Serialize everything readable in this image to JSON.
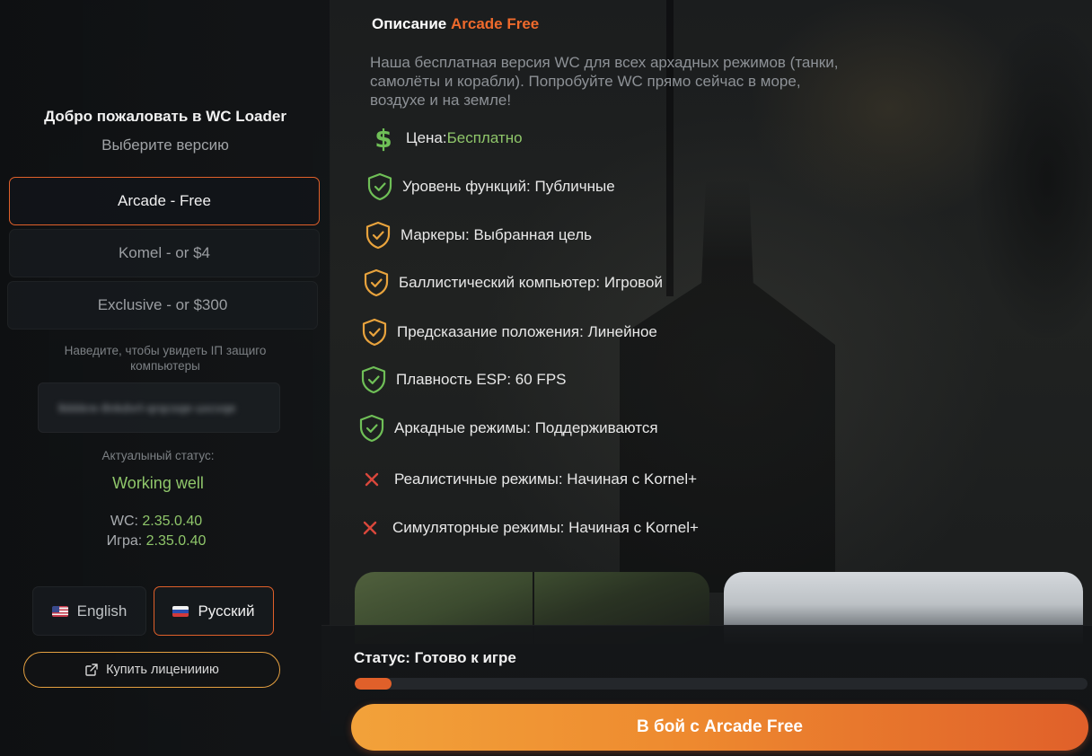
{
  "sidebar": {
    "welcome": "Добро пожаловать в WC Loader",
    "choose_version": "Выберите версию",
    "versions": [
      {
        "label": "Arcade - Free",
        "active": true
      },
      {
        "label": "Komel - or $4",
        "active": false
      },
      {
        "label": "Exclusive - or $300",
        "active": false
      }
    ],
    "ip_hint": "Наведите, чтобы увидеть IП защиго компьютеры",
    "ip_value": "lkkkkre-8nkdvrl-qrqcsqe-uxcvqe",
    "status_label": "Актуалыный статус:",
    "status_value": "Working well",
    "wc_label": "WC:",
    "wc_version": "2.35.0.40",
    "game_label": "Игра:",
    "game_version": "2.35.0.40",
    "languages": [
      {
        "label": "English",
        "flag": "us",
        "active": false
      },
      {
        "label": "Русский",
        "flag": "ru",
        "active": true
      }
    ],
    "buy_label": "Купить лиценииию"
  },
  "main": {
    "title_prefix": "Описание ",
    "title_accent": "Arcade Free",
    "description": "Наша бесплатная версия WC для всех архадных режимов (танки, самолёты и корабли). Попробуйте WC прямо сейчас в море, воздухе и на земле!",
    "price_label": "Цена: ",
    "price_value": "Бесплатно",
    "features": [
      {
        "text": "Уровень функций: Публичные",
        "icon": "shield-check-icon",
        "color": "#6fbf57"
      },
      {
        "text": "Маркеры: Выбранная цель",
        "icon": "shield-check-icon",
        "color": "#e8a33d"
      },
      {
        "text": "Баллистический компьютер: Игровой",
        "icon": "shield-check-icon",
        "color": "#e8a33d"
      },
      {
        "text": "Предсказание положения: Линейное",
        "icon": "shield-check-icon",
        "color": "#e8a33d"
      },
      {
        "text": "Плавность ESP: 60 FPS",
        "icon": "shield-check-icon",
        "color": "#6fbf57"
      },
      {
        "text": "Аркадные режимы: Поддерживаются",
        "icon": "shield-check-icon",
        "color": "#6fbf57"
      },
      {
        "text": "Реалистичные режимы: Начиная с Kornel+",
        "icon": "x-icon",
        "color": "#d9473b"
      },
      {
        "text": "Симуляторные режимы: Начиная с Kornel+",
        "icon": "x-icon",
        "color": "#d9473b"
      }
    ]
  },
  "footer": {
    "status": "Статус: Готово к игре",
    "progress": 0.05,
    "play_label": "В бой с Arcade Free"
  },
  "colors": {
    "accent": "#e0602a",
    "gold": "#e8a33d",
    "green": "#8fc66a"
  }
}
